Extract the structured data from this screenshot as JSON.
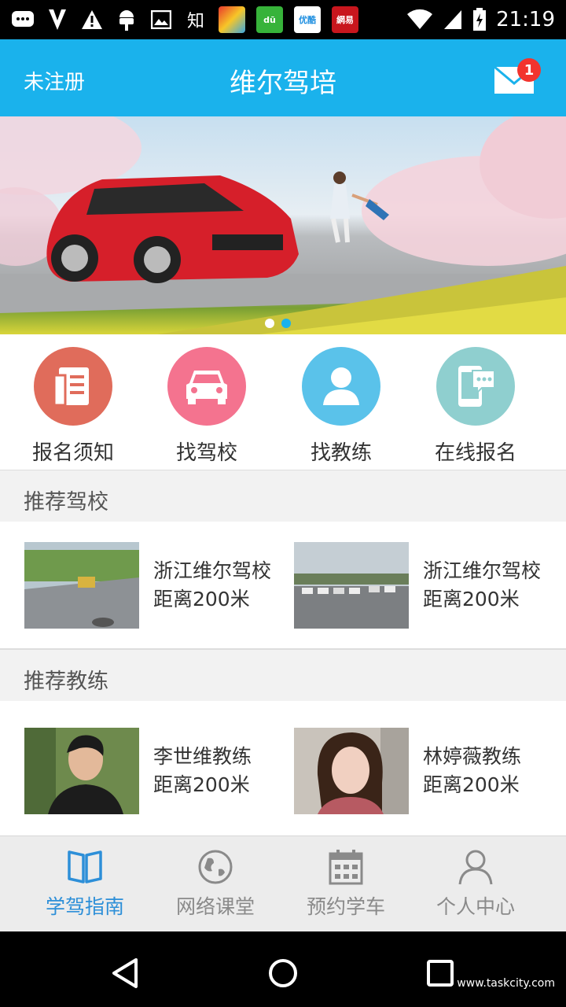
{
  "status_bar": {
    "time": "21:19",
    "app_icons": [
      {
        "name": "zhihu",
        "label": "知"
      },
      {
        "name": "duokan",
        "label": "dū",
        "color": "#37b33a"
      },
      {
        "name": "youku",
        "label": "优酷",
        "color": "#ffffff"
      },
      {
        "name": "netease",
        "label": "網易",
        "color": "#c8161d"
      }
    ]
  },
  "header": {
    "left_label": "未注册",
    "title": "维尔驾培",
    "mail_badge": "1"
  },
  "banner": {
    "active_dot": 1,
    "dot_count": 2,
    "colors": {
      "dot_inactive": "#ffffff",
      "dot_active": "#1ab2ec"
    }
  },
  "quick_entries": [
    {
      "label": "报名须知",
      "icon": "document-icon",
      "color": "#e06c5b"
    },
    {
      "label": "找驾校",
      "icon": "car-icon",
      "color": "#f4738f"
    },
    {
      "label": "找教练",
      "icon": "person-icon",
      "color": "#5ac2ea"
    },
    {
      "label": "在线报名",
      "icon": "phone-chat-icon",
      "color": "#8fcfcf"
    }
  ],
  "sections": {
    "schools_title": "推荐驾校",
    "coaches_title": "推荐教练"
  },
  "schools": [
    {
      "name": "浙江维尔驾校",
      "distance": "距离200米"
    },
    {
      "name": "浙江维尔驾校",
      "distance": "距离200米"
    }
  ],
  "coaches": [
    {
      "name": "李世维教练",
      "distance": "距离200米"
    },
    {
      "name": "林婷薇教练",
      "distance": "距离200米"
    }
  ],
  "tabs": [
    {
      "label": "学驾指南",
      "icon": "book-icon",
      "active": true
    },
    {
      "label": "网络课堂",
      "icon": "globe-icon",
      "active": false
    },
    {
      "label": "预约学车",
      "icon": "calendar-icon",
      "active": false
    },
    {
      "label": "个人中心",
      "icon": "user-icon",
      "active": false
    }
  ],
  "watermark": "www.taskcity.com",
  "colors": {
    "header": "#1ab2ec",
    "tab_active": "#2d8fd8",
    "tab_inactive": "#8a8a8a",
    "badge": "#f2342e"
  }
}
